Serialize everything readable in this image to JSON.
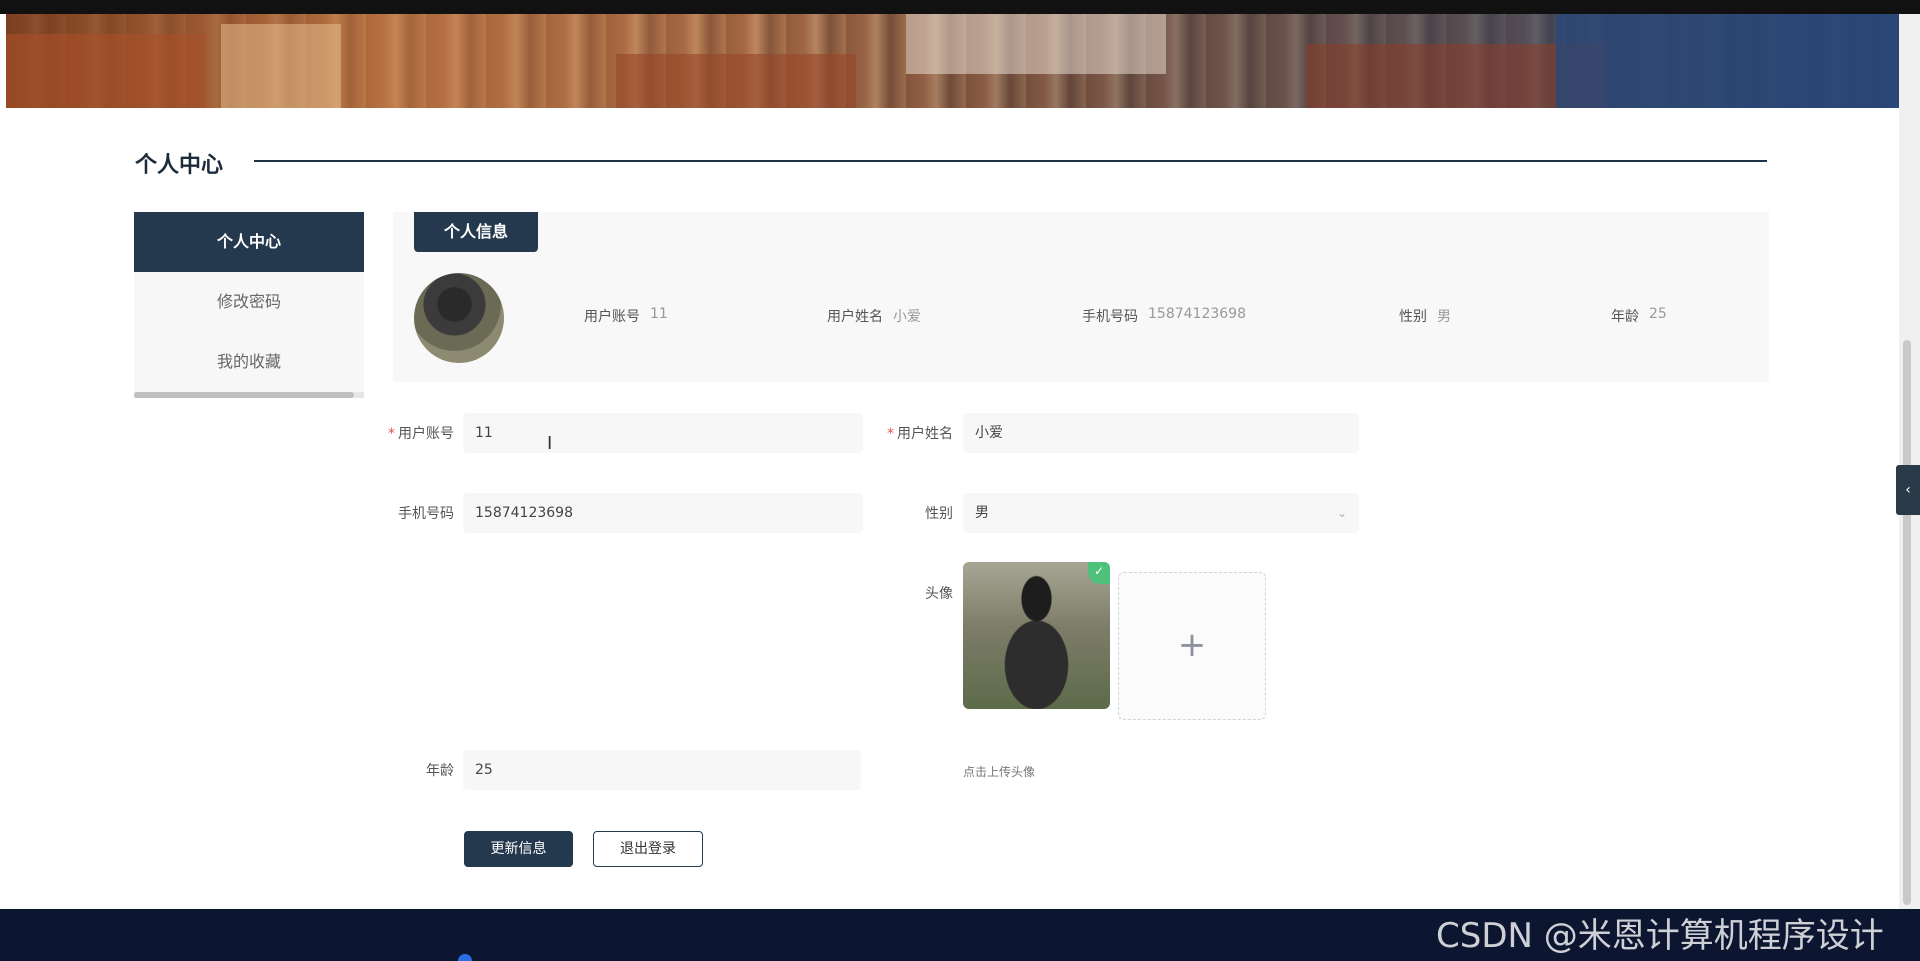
{
  "section": {
    "title": "个人中心"
  },
  "menu": {
    "items": [
      {
        "label": "个人中心"
      },
      {
        "label": "修改密码"
      },
      {
        "label": "我的收藏"
      }
    ]
  },
  "info": {
    "tab": "个人信息",
    "fields": [
      {
        "key": "用户账号",
        "value": "11"
      },
      {
        "key": "用户姓名",
        "value": "小爱"
      },
      {
        "key": "手机号码",
        "value": "15874123698"
      },
      {
        "key": "性别",
        "value": "男"
      },
      {
        "key": "年龄",
        "value": "25"
      }
    ]
  },
  "form": {
    "account_label": "用户账号",
    "account_value": "11",
    "name_label": "用户姓名",
    "name_value": "小爱",
    "phone_label": "手机号码",
    "phone_value": "15874123698",
    "gender_label": "性别",
    "gender_value": "男",
    "avatar_label": "头像",
    "age_label": "年龄",
    "age_value": "25",
    "upload_plus": "+",
    "upload_hint": "点击上传头像",
    "required_mark": "*"
  },
  "buttons": {
    "update": "更新信息",
    "logout": "退出登录"
  },
  "side_tab_icon": "‹",
  "watermark": "CSDN @米恩计算机程序设计"
}
